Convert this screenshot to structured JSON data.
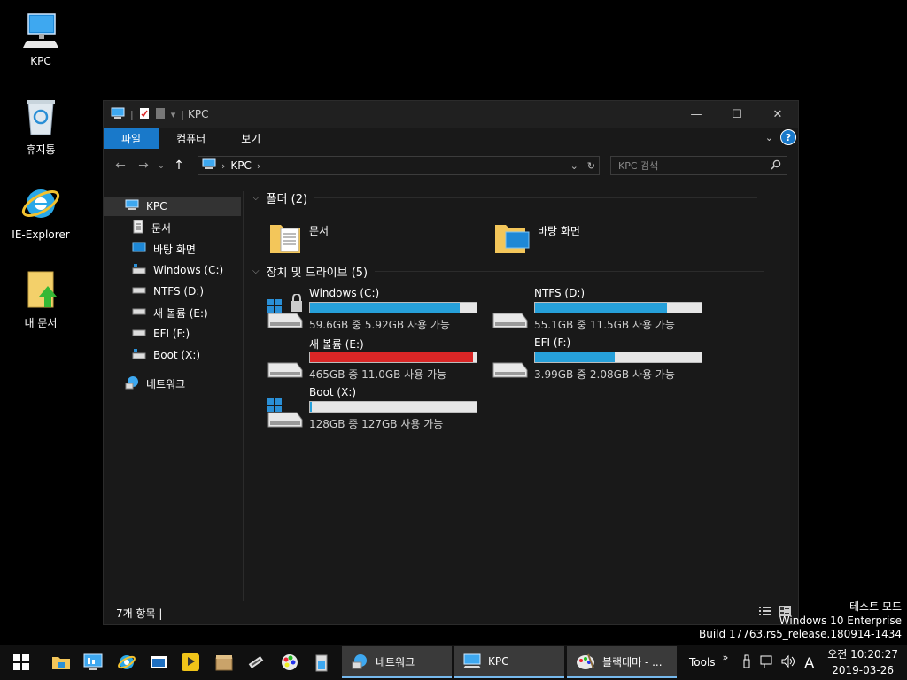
{
  "desktop": {
    "icons": [
      {
        "label": "KPC"
      },
      {
        "label": "휴지통"
      },
      {
        "label": "IE-Explorer"
      },
      {
        "label": "내 문서"
      }
    ]
  },
  "window": {
    "title": "KPC",
    "ribbon_tabs": [
      "파일",
      "컴퓨터",
      "보기"
    ],
    "help": "?",
    "address_crumb": "KPC",
    "search_placeholder": "KPC 검색",
    "nav_items": [
      "KPC",
      "문서",
      "바탕 화면",
      "Windows (C:)",
      "NTFS (D:)",
      "새 볼륨 (E:)",
      "EFI (F:)",
      "Boot (X:)",
      "네트워크"
    ],
    "folders_group": "폴더 (2)",
    "folders": [
      "문서",
      "바탕 화면"
    ],
    "drives_group": "장치 및 드라이브 (5)",
    "drives": [
      {
        "name": "Windows (C:)",
        "free": "59.6GB 중 5.92GB 사용 가능",
        "used_fraction": 0.9,
        "color": "#26a0da"
      },
      {
        "name": "NTFS (D:)",
        "free": "55.1GB 중 11.5GB 사용 가능",
        "used_fraction": 0.79,
        "color": "#26a0da"
      },
      {
        "name": "새 볼륨 (E:)",
        "free": "465GB 중 11.0GB 사용 가능",
        "used_fraction": 0.98,
        "color": "#da2626"
      },
      {
        "name": "EFI (F:)",
        "free": "3.99GB 중 2.08GB 사용 가능",
        "used_fraction": 0.48,
        "color": "#26a0da"
      },
      {
        "name": "Boot (X:)",
        "free": "128GB 중 127GB 사용 가능",
        "used_fraction": 0.01,
        "color": "#26a0da"
      }
    ],
    "status_text": "7개 항목 |"
  },
  "watermark": {
    "line1": "테스트 모드",
    "line2": "Windows 10 Enterprise",
    "line3": "Build 17763.rs5_release.180914-1434"
  },
  "taskbar": {
    "tasks": [
      "네트워크",
      "KPC",
      "블랙테마 - ..."
    ],
    "tools_label": "Tools",
    "ime": "A",
    "time": "오전 10:20:27",
    "date": "2019-03-26"
  },
  "colors": {
    "accent": "#1979ca",
    "drive_bar": "#26a0da",
    "drive_bar_full": "#da2626"
  }
}
